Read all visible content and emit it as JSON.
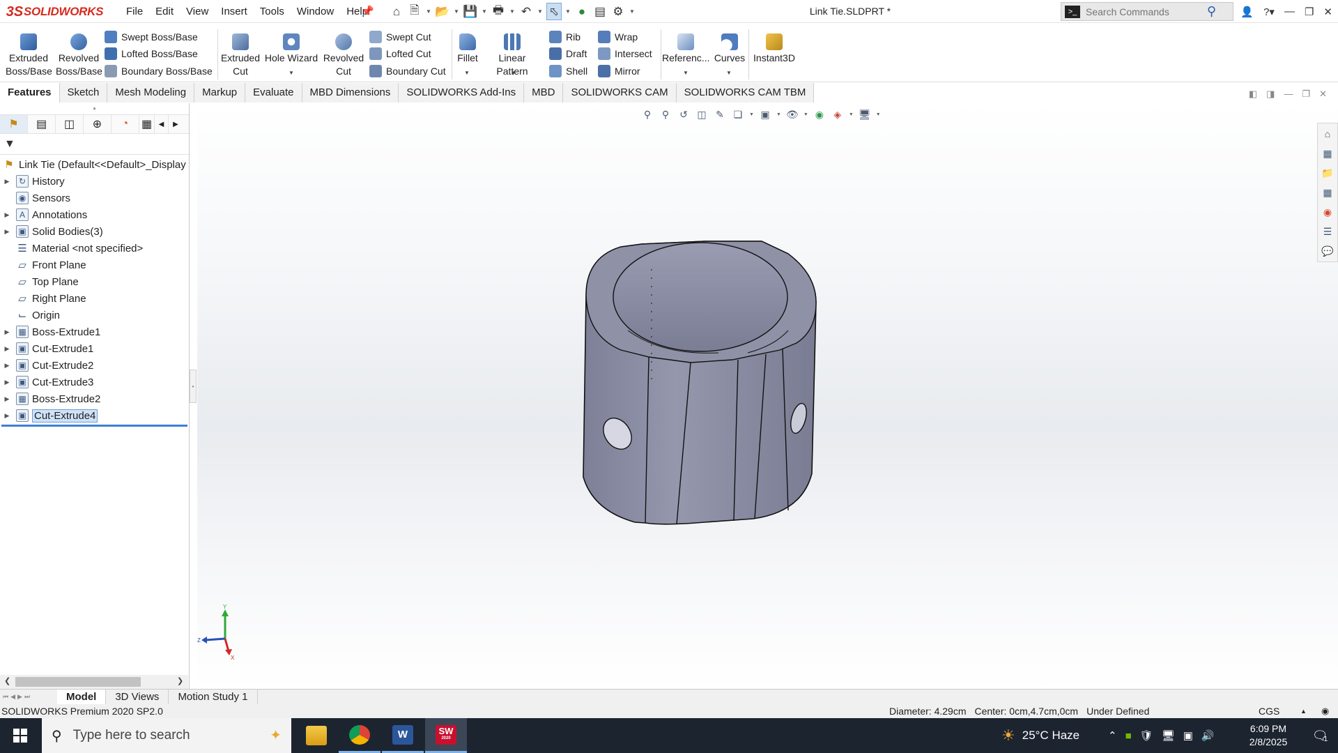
{
  "app": {
    "brand": "SOLIDWORKS",
    "document_title": "Link Tie.SLDPRT *",
    "menu": [
      "File",
      "Edit",
      "View",
      "Insert",
      "Tools",
      "Window",
      "Help"
    ]
  },
  "search": {
    "placeholder": "Search Commands"
  },
  "commands": {
    "extruded_boss": "Extruded Boss/Base",
    "revolved_boss": "Revolved Boss/Base",
    "swept_boss": "Swept Boss/Base",
    "lofted_boss": "Lofted Boss/Base",
    "boundary_boss": "Boundary Boss/Base",
    "extruded_cut": "Extruded Cut",
    "hole_wizard": "Hole Wizard",
    "revolved_cut": "Revolved Cut",
    "swept_cut": "Swept Cut",
    "lofted_cut": "Lofted Cut",
    "boundary_cut": "Boundary Cut",
    "fillet": "Fillet",
    "linear_pattern": "Linear Pattern",
    "rib": "Rib",
    "draft": "Draft",
    "shell": "Shell",
    "wrap": "Wrap",
    "intersect": "Intersect",
    "mirror": "Mirror",
    "reference": "Referenc...",
    "curves": "Curves",
    "instant3d": "Instant3D"
  },
  "tabs": [
    "Features",
    "Sketch",
    "Mesh Modeling",
    "Markup",
    "Evaluate",
    "MBD Dimensions",
    "SOLIDWORKS Add-Ins",
    "MBD",
    "SOLIDWORKS CAM",
    "SOLIDWORKS CAM TBM"
  ],
  "tree": {
    "root": "Link Tie  (Default<<Default>_Display",
    "items": [
      {
        "label": "History",
        "icon": "history-icon",
        "expandable": true
      },
      {
        "label": "Sensors",
        "icon": "sensors-icon",
        "expandable": false
      },
      {
        "label": "Annotations",
        "icon": "annotations-icon",
        "expandable": true
      },
      {
        "label": "Solid Bodies(3)",
        "icon": "solid-bodies-icon",
        "expandable": true
      },
      {
        "label": "Material <not specified>",
        "icon": "material-icon",
        "expandable": false
      },
      {
        "label": "Front Plane",
        "icon": "plane-icon",
        "expandable": false
      },
      {
        "label": "Top Plane",
        "icon": "plane-icon",
        "expandable": false
      },
      {
        "label": "Right Plane",
        "icon": "plane-icon",
        "expandable": false
      },
      {
        "label": "Origin",
        "icon": "origin-icon",
        "expandable": false
      },
      {
        "label": "Boss-Extrude1",
        "icon": "boss-extrude-icon",
        "expandable": true
      },
      {
        "label": "Cut-Extrude1",
        "icon": "cut-extrude-icon",
        "expandable": true
      },
      {
        "label": "Cut-Extrude2",
        "icon": "cut-extrude-icon",
        "expandable": true
      },
      {
        "label": "Cut-Extrude3",
        "icon": "cut-extrude-icon",
        "expandable": true
      },
      {
        "label": "Boss-Extrude2",
        "icon": "boss-extrude-icon",
        "expandable": true
      },
      {
        "label": "Cut-Extrude4",
        "icon": "cut-extrude-icon",
        "expandable": true,
        "selected": true
      }
    ]
  },
  "bottom_tabs": [
    "Model",
    "3D Views",
    "Motion Study 1"
  ],
  "status": {
    "version": "SOLIDWORKS Premium 2020 SP2.0",
    "diameter": "Diameter: 4.29cm",
    "center": "Center: 0cm,4.7cm,0cm",
    "state": "Under Defined",
    "units": "CGS"
  },
  "taskbar": {
    "search_placeholder": "Type here to search",
    "apps": [
      "file-explorer",
      "chrome",
      "word",
      "solidworks"
    ],
    "solidworks_badge": "2020",
    "weather": "25°C  Haze",
    "time": "6:09 PM",
    "date": "2/8/2025",
    "notification_count": "1"
  },
  "colors": {
    "brand": "#d52b1e",
    "selection": "#3d7fd3",
    "model_face": "#8d8fa6",
    "taskbar": "#1c2430"
  }
}
